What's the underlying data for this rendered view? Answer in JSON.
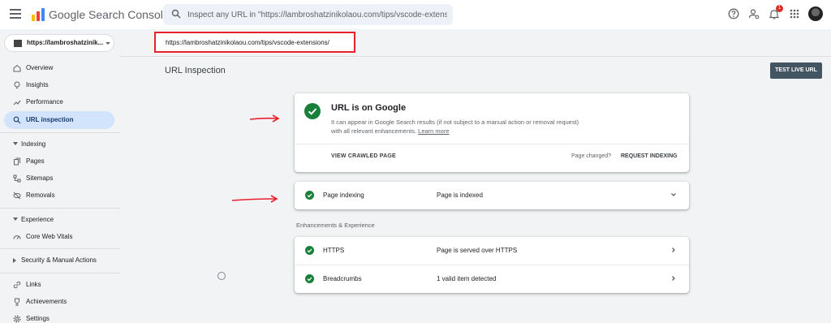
{
  "header": {
    "app_title": "Google Search Console",
    "search_placeholder": "Inspect any URL in \"https://lambroshatzinikolaou.com/tips/vscode-extensions/\"",
    "notification_count": "1"
  },
  "property": {
    "label": "https://lambroshatzinik..."
  },
  "inspected_url": "https://lambroshatzinikolaou.com/tips/vscode-extensions/",
  "sidebar": {
    "items": [
      {
        "label": "Overview",
        "icon": "home-icon"
      },
      {
        "label": "Insights",
        "icon": "lightbulb-icon"
      },
      {
        "label": "Performance",
        "icon": "trending-up-icon"
      },
      {
        "label": "URL inspection",
        "icon": "search-icon",
        "active": true
      }
    ],
    "indexing": {
      "title": "Indexing",
      "items": [
        {
          "label": "Pages",
          "icon": "pages-icon"
        },
        {
          "label": "Sitemaps",
          "icon": "sitemap-icon"
        },
        {
          "label": "Removals",
          "icon": "removals-icon"
        }
      ]
    },
    "experience": {
      "title": "Experience",
      "items": [
        {
          "label": "Core Web Vitals",
          "icon": "gauge-icon"
        }
      ]
    },
    "security": {
      "title": "Security & Manual Actions"
    },
    "bottom_items": [
      {
        "label": "Links",
        "icon": "link-icon"
      },
      {
        "label": "Achievements",
        "icon": "trophy-icon"
      },
      {
        "label": "Settings",
        "icon": "gear-icon"
      }
    ]
  },
  "main": {
    "title": "URL Inspection",
    "test_live_label": "TEST LIVE URL",
    "status": {
      "title": "URL is on Google",
      "description": "It can appear in Google Search results (if not subject to a manual action or removal request) with all relevant enhancements.",
      "learn_more": "Learn more",
      "view_crawled": "VIEW CRAWLED PAGE",
      "page_changed": "Page changed?",
      "request_indexing": "REQUEST INDEXING"
    },
    "page_indexing": {
      "label": "Page indexing",
      "value": "Page is indexed"
    },
    "enhancements_title": "Enhancements & Experience",
    "enhancements": [
      {
        "label": "HTTPS",
        "value": "Page is served over HTTPS"
      },
      {
        "label": "Breadcrumbs",
        "value": "1 valid item detected"
      }
    ]
  },
  "colors": {
    "success_green": "#188038",
    "active_nav_bg": "#d2e3fc",
    "highlight_red": "#e8202f",
    "button_dark": "#445562"
  }
}
